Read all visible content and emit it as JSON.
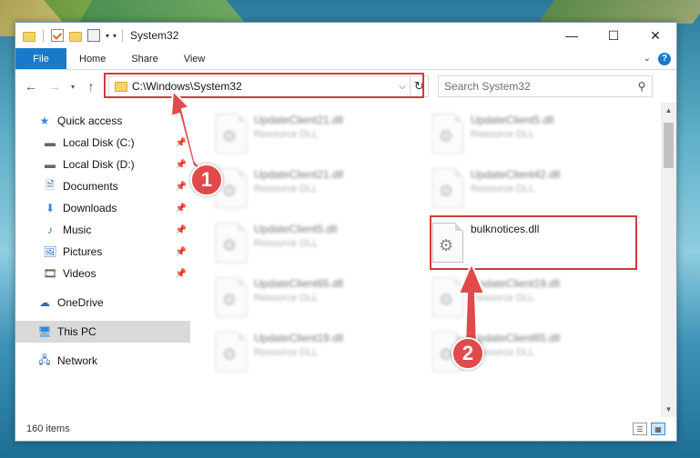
{
  "title": "System32",
  "window_buttons": {
    "minimize": "—",
    "maximize": "☐",
    "close": "✕"
  },
  "ribbon": {
    "tabs": [
      "File",
      "Home",
      "Share",
      "View"
    ],
    "help": "?"
  },
  "nav": {
    "back": "←",
    "forward": "→",
    "recent": "▾",
    "up": "↑"
  },
  "address": {
    "path": "C:\\Windows\\System32",
    "dropdown": "⌵",
    "refresh": "↻"
  },
  "search": {
    "placeholder": "Search System32"
  },
  "sidebar": {
    "items": [
      {
        "label": "Quick access",
        "icon": "★"
      },
      {
        "label": "Local Disk (C:)",
        "icon": "▬",
        "pin": "📌"
      },
      {
        "label": "Local Disk (D:)",
        "icon": "▬",
        "pin": "📌"
      },
      {
        "label": "Documents",
        "icon": "🗎",
        "pin": "📌"
      },
      {
        "label": "Downloads",
        "icon": "⬇",
        "pin": "📌"
      },
      {
        "label": "Music",
        "icon": "♪",
        "pin": "📌"
      },
      {
        "label": "Pictures",
        "icon": "🖼",
        "pin": "📌"
      },
      {
        "label": "Videos",
        "icon": "🎞",
        "pin": "📌"
      },
      {
        "label": "OneDrive",
        "icon": "☁"
      },
      {
        "label": "This PC",
        "icon": "🖥"
      },
      {
        "label": "Network",
        "icon": "🖧"
      }
    ]
  },
  "files": [
    {
      "name": "UpdateClient21.dll",
      "type": "Resource DLL"
    },
    {
      "name": "UpdateClient5.dll",
      "type": "Resource DLL"
    },
    {
      "name": "UpdateClient21.dll",
      "type": "Resource DLL"
    },
    {
      "name": "UpdateClient42.dll",
      "type": "Resource DLL"
    },
    {
      "name": "UpdateClient5.dll",
      "type": "Resource DLL"
    },
    {
      "name": "bulknotices.dll",
      "type": ""
    },
    {
      "name": "UpdateClient65.dll",
      "type": "Resource DLL"
    },
    {
      "name": "UpdateClient19.dll",
      "type": "Resource DLL"
    },
    {
      "name": "UpdateClient19.dll",
      "type": "Resource DLL"
    },
    {
      "name": "UpdateClient65.dll",
      "type": "Resource DLL"
    }
  ],
  "status": {
    "item_count": "160 items"
  },
  "callouts": [
    "1",
    "2"
  ],
  "colors": {
    "accent": "#1979ca",
    "highlight": "#d23b3b",
    "callout": "#e04a4a"
  }
}
